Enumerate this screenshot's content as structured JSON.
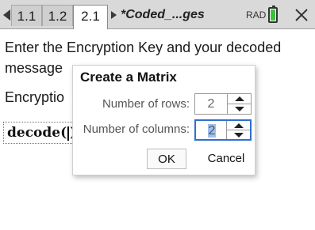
{
  "topbar": {
    "tabs": [
      {
        "label": "1.1",
        "active": false
      },
      {
        "label": "1.2",
        "active": false
      },
      {
        "label": "2.1",
        "active": true
      }
    ],
    "document_name": "*Coded_...ges",
    "angle_mode": "RAD",
    "battery_color": "#3fbf3f"
  },
  "content": {
    "line1": "Enter the Encryption Key and your decoded",
    "line2": "message",
    "line3": "Encryptio",
    "math_expr": "decode"
  },
  "dialog": {
    "title": "Create a Matrix",
    "rows_label": "Number of rows:",
    "rows_value": "2",
    "columns_label": "Number of columns:",
    "columns_value": "2",
    "ok_label": "OK",
    "cancel_label": "Cancel",
    "focus_color": "#2f6fd0"
  }
}
